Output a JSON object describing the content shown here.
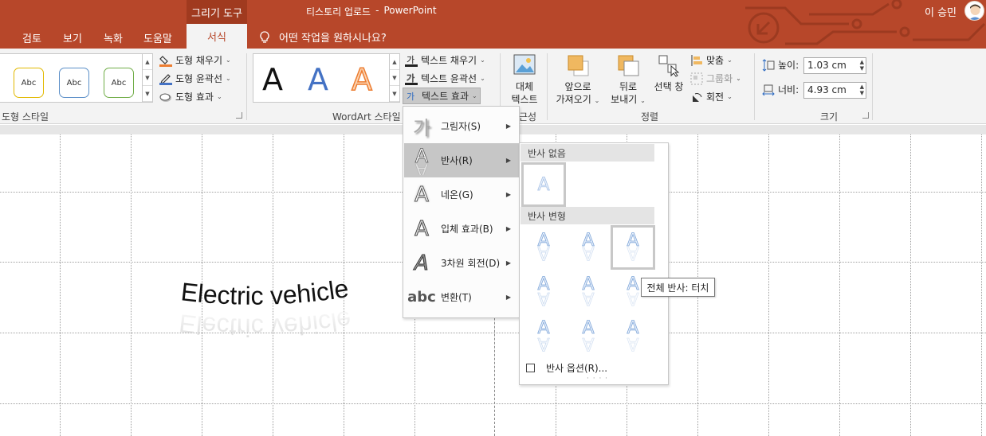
{
  "window": {
    "context_tab": "그리기 도구",
    "file_name": "티스토리 업로드",
    "title_sep": "-",
    "app_name": "PowerPoint",
    "user": "이 승민"
  },
  "tabs": [
    "검토",
    "보기",
    "녹화",
    "도움말"
  ],
  "active_tab": "서식",
  "tell_me": "어떤 작업을 원하시나요?",
  "ribbon": {
    "shape_styles": {
      "presets": [
        "Abc",
        "Abc",
        "Abc"
      ],
      "preset_colors": [
        "#e2b900",
        "#5b8fc8",
        "#70ad47"
      ],
      "fill": "도형 채우기",
      "outline": "도형 윤곽선",
      "effects": "도형 효과",
      "label": "도형 스타일"
    },
    "wordart": {
      "letters": [
        "A",
        "A",
        "A"
      ],
      "colors": [
        "#111111",
        "#4472c4",
        "#ed7d31"
      ],
      "text_fill": "텍스트 채우기",
      "text_outline": "텍스트 윤곽선",
      "text_effects": "텍스트 효과",
      "label": "WordArt 스타일"
    },
    "accessibility": {
      "alt_text_1": "대체",
      "alt_text_2": "텍스트",
      "label": "근성"
    },
    "arrange": {
      "forward_1": "앞으로",
      "forward_2": "가져오기",
      "backward_1": "뒤로",
      "backward_2": "보내기",
      "selection_pane": "선택 창",
      "align": "맞춤",
      "group": "그룹화",
      "rotate": "회전",
      "label": "정렬"
    },
    "size": {
      "height_label": "높이:",
      "height_value": "1.03 cm",
      "width_label": "너비:",
      "width_value": "4.93 cm",
      "label": "크기"
    }
  },
  "slide": {
    "wordart_text": "Electric vehicle"
  },
  "text_effects_menu": {
    "items": [
      {
        "label": "그림자(S)",
        "glyph": "가"
      },
      {
        "label": "반사(R)",
        "glyph": "A"
      },
      {
        "label": "네온(G)",
        "glyph": "A"
      },
      {
        "label": "입체 효과(B)",
        "glyph": "A"
      },
      {
        "label": "3차원 회전(D)",
        "glyph": "A"
      },
      {
        "label": "변환(T)",
        "glyph": "abc"
      }
    ],
    "active_index": 1
  },
  "reflection_menu": {
    "no_reflection": "반사 없음",
    "variations": "반사 변형",
    "options": "반사 옵션(R)...",
    "glyph": "A",
    "glyph_color": "#7fa6d9"
  },
  "tooltip": "전체 반사: 터치"
}
